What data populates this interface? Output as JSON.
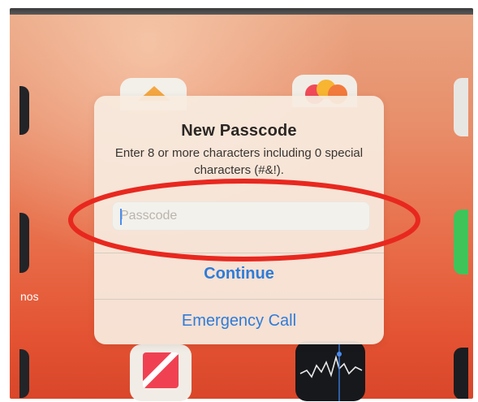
{
  "dialog": {
    "title": "New Passcode",
    "message": "Enter 8 or more characters including 0 special characters (#&!).",
    "field": {
      "placeholder": "Passcode",
      "value": ""
    },
    "continue_label": "Continue",
    "emergency_label": "Emergency Call"
  },
  "background": {
    "dock_label_fragment": "nos"
  },
  "icons": [
    "home-app-icon",
    "photos-app-icon",
    "news-app-icon",
    "stocks-app-icon"
  ],
  "colors": {
    "button_blue": "#2f7bd8",
    "annotation_red": "#e8281f",
    "wallpaper_orange": "#e86b47"
  }
}
